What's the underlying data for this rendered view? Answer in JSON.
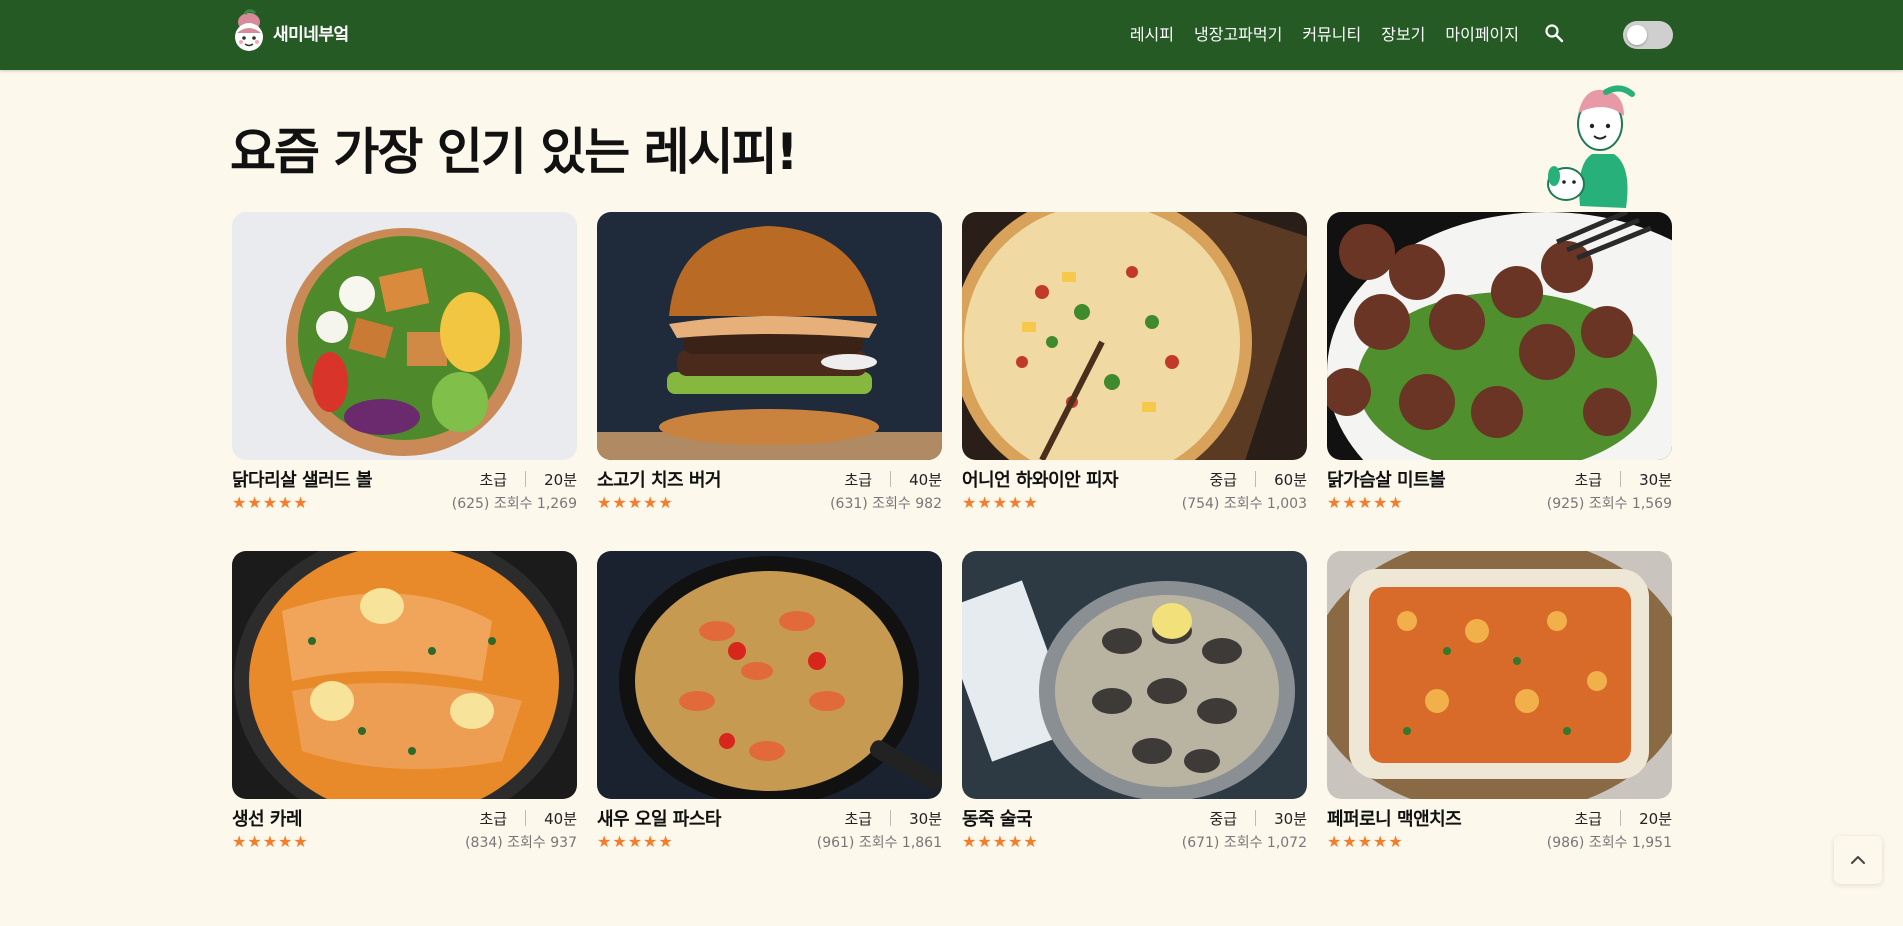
{
  "header": {
    "brand_name": "새미네부엌",
    "nav": [
      "레시피",
      "냉장고파먹기",
      "커뮤니티",
      "장보기",
      "마이페이지"
    ],
    "search_icon": "search-icon",
    "theme_toggle": "off"
  },
  "page_title": "요즘 가장 인기 있는 레시피!",
  "colors": {
    "header_bg": "#265a25",
    "page_bg": "#fdf8ec",
    "star": "#f57c2b"
  },
  "recipes": [
    {
      "name": "닭다리살 샐러드 볼",
      "level": "초급",
      "time": "20분",
      "stars": 5,
      "stats": "(625) 조회수 1,269"
    },
    {
      "name": "소고기 치즈 버거",
      "level": "초급",
      "time": "40분",
      "stars": 5,
      "stats": "(631) 조회수 982"
    },
    {
      "name": "어니언 하와이안 피자",
      "level": "중급",
      "time": "60분",
      "stars": 5,
      "stats": "(754) 조회수 1,003"
    },
    {
      "name": "닭가슴살 미트볼",
      "level": "초급",
      "time": "30분",
      "stars": 5,
      "stats": "(925) 조회수 1,569"
    },
    {
      "name": "생선 카레",
      "level": "초급",
      "time": "40분",
      "stars": 5,
      "stats": "(834) 조회수 937"
    },
    {
      "name": "새우 오일 파스타",
      "level": "초급",
      "time": "30분",
      "stars": 5,
      "stats": "(961) 조회수 1,861"
    },
    {
      "name": "동죽 술국",
      "level": "중급",
      "time": "30분",
      "stars": 5,
      "stats": "(671) 조회수 1,072"
    },
    {
      "name": "페퍼로니 맥앤치즈",
      "level": "초급",
      "time": "20분",
      "stars": 5,
      "stats": "(986) 조회수 1,951"
    }
  ]
}
